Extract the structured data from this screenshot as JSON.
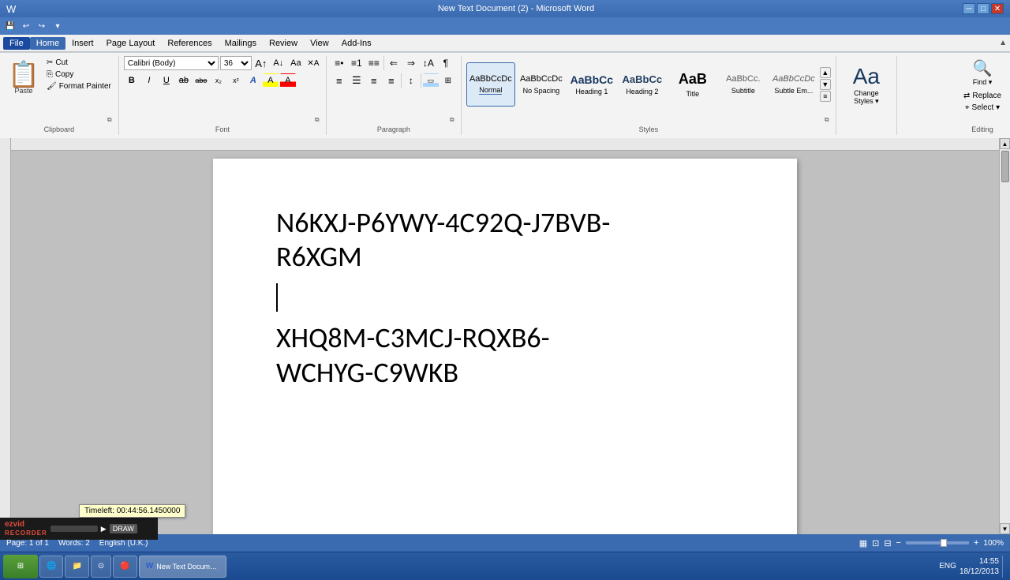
{
  "titlebar": {
    "title": "New Text Document (2) - Microsoft Word",
    "min_btn": "─",
    "max_btn": "□",
    "close_btn": "✕"
  },
  "qat": {
    "save": "💾",
    "undo": "↩",
    "redo": "↪",
    "customize": "▾"
  },
  "ribbon": {
    "tabs": [
      "File",
      "Home",
      "Insert",
      "Page Layout",
      "References",
      "Mailings",
      "Review",
      "View",
      "Add-Ins"
    ],
    "active_tab": "Home",
    "groups": {
      "clipboard": {
        "label": "Clipboard",
        "paste_label": "Paste",
        "cut_label": "Cut",
        "copy_label": "Copy",
        "format_painter_label": "Format Painter"
      },
      "font": {
        "label": "Font",
        "font_name": "Calibri (Body)",
        "font_size": "36",
        "bold": "B",
        "italic": "I",
        "underline": "U",
        "strikethrough": "ab",
        "subscript": "x₂",
        "superscript": "x²",
        "change_case": "Aa",
        "text_effects": "A",
        "highlight": "A",
        "font_color": "A"
      },
      "paragraph": {
        "label": "Paragraph",
        "bullets": "≡",
        "numbering": "≡",
        "multilevel": "≡",
        "decrease_indent": "⇐",
        "increase_indent": "⇒",
        "sort": "↕",
        "show_all": "¶",
        "align_left": "≡",
        "align_center": "≡",
        "align_right": "≡",
        "justify": "≡",
        "line_spacing": "↕",
        "shading": "▭",
        "borders": "▦"
      },
      "styles": {
        "label": "Styles",
        "items": [
          {
            "id": "normal",
            "label": "Normal",
            "preview": "AaBbCcDc",
            "active": true
          },
          {
            "id": "no-spacing",
            "label": "No Spacing",
            "preview": "AaBbCcDc"
          },
          {
            "id": "heading1",
            "label": "Heading 1",
            "preview": "AaBbCc"
          },
          {
            "id": "heading2",
            "label": "Heading 2",
            "preview": "AaBbCc"
          },
          {
            "id": "title",
            "label": "Title",
            "preview": "AaB"
          },
          {
            "id": "subtitle",
            "label": "Subtitle",
            "preview": "AaBbCc."
          },
          {
            "id": "subtle-em",
            "label": "Subtle Em...",
            "preview": "AaBbCcDc"
          }
        ]
      },
      "change_styles": {
        "label": "Change\nStyles",
        "icon": "Aa▾"
      },
      "editing": {
        "label": "Editing",
        "find_label": "Find ▾",
        "replace_label": "Replace",
        "select_label": "Select ▾"
      }
    }
  },
  "document": {
    "text_block1_line1": "N6KXJ-P6YWY-4C92Q-J7BVB-",
    "text_block1_line2": "R6XGM",
    "text_block2_line1": "XHQ8M-C3MCJ-RQXB6-",
    "text_block2_line2": "WCHYG-C9WKB"
  },
  "statusbar": {
    "page_info": "Page: 1 of 1",
    "words": "Words: 2",
    "language": "English (U.K.)",
    "zoom": "100%",
    "view_modes": [
      "▦",
      "≡",
      "▤",
      "▦",
      "▣"
    ]
  },
  "taskbar": {
    "start_label": "⊞",
    "apps": [
      {
        "id": "ie",
        "label": "IE"
      },
      {
        "id": "explorer",
        "label": "📁"
      },
      {
        "id": "chrome",
        "label": "Chrome"
      },
      {
        "id": "ball",
        "label": "🔴"
      },
      {
        "id": "word",
        "label": "W",
        "active": true
      }
    ],
    "tray": {
      "time": "14:55",
      "date": "18/12/2013",
      "language": "ENG"
    }
  },
  "ezvid": {
    "logo": "ezvid\nRECORDER",
    "draw_label": "DRAW",
    "tooltip": "Timeleft: 00:44:56.1450000"
  }
}
